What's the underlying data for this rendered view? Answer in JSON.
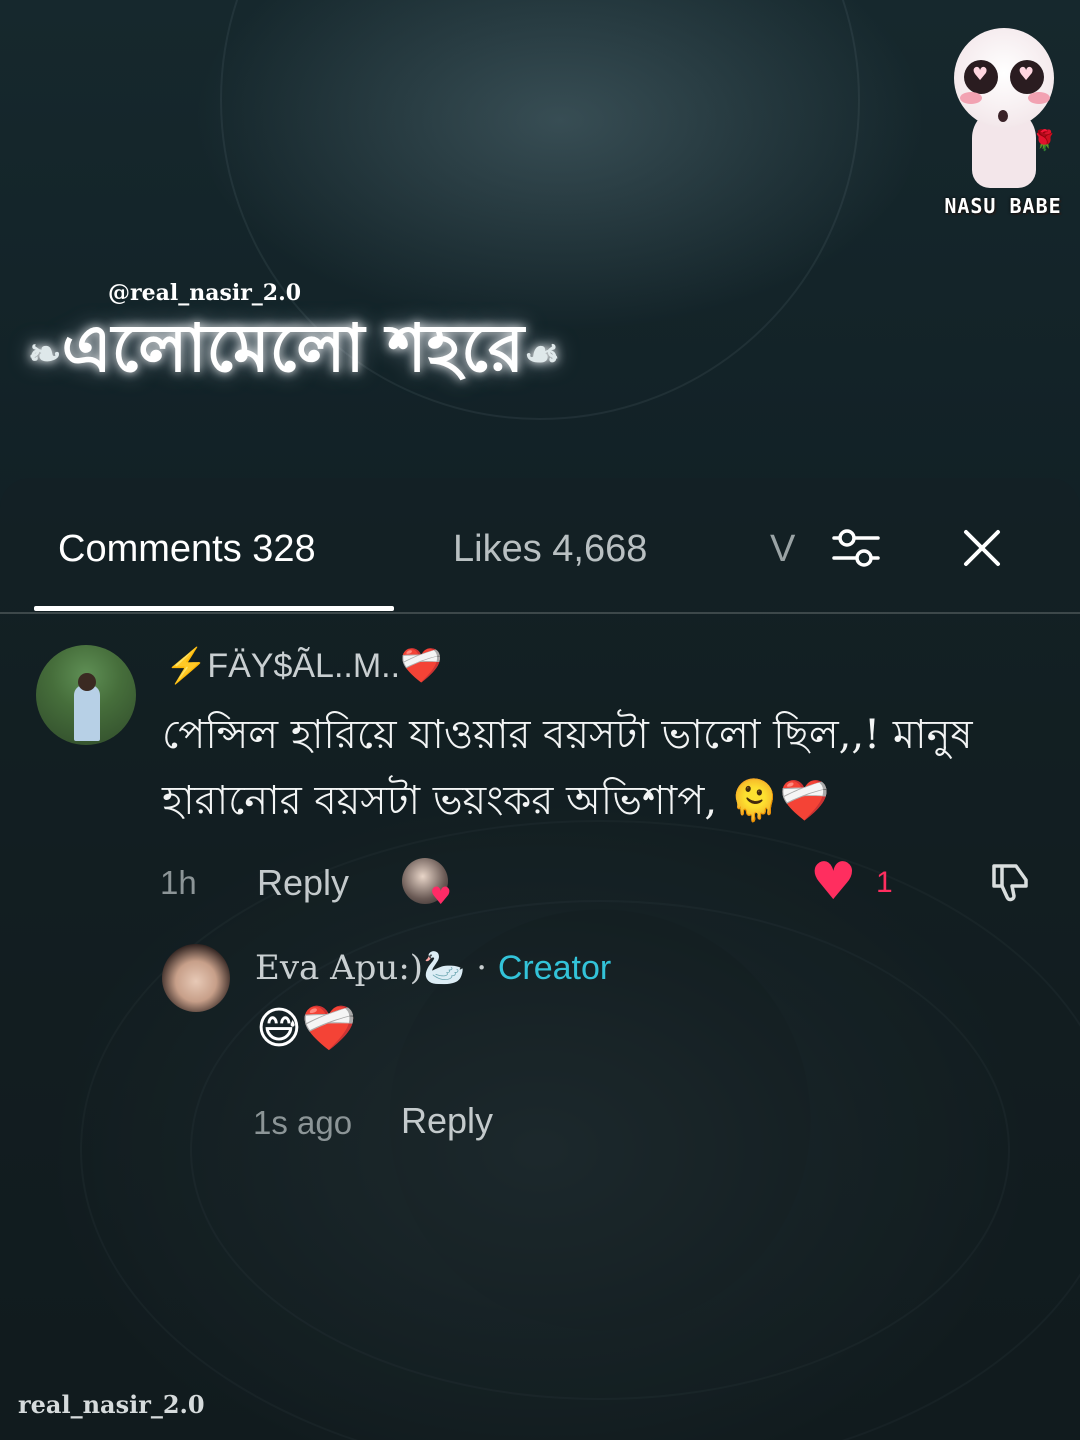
{
  "overlay": {
    "brand_name": "NASU BABE",
    "handle": "@real_nasir_2.0",
    "song_title": "এলোমেলো শহরে",
    "watermark": "real_nasir_2.0"
  },
  "tabs": {
    "comments_label": "Comments 328",
    "likes_label": "Likes 4,668",
    "more_label": "V",
    "filter_icon": "sliders-icon",
    "close_icon": "close-icon"
  },
  "comment": {
    "author": "⚡FÄY$ÃL..M..❤️‍🩹",
    "text": "পেন্সিল হারিয়ে যাওয়ার বয়সটা ভালো ছিল,,! মানুষ হারানোর বয়সটা ভয়ংকর অভিশাপ, 🫠❤️‍🩹",
    "time": "1h",
    "reply_label": "Reply",
    "like_count": "1",
    "liked": true,
    "colors": {
      "like": "#ff2e5f"
    }
  },
  "reply": {
    "author": "Eva Apu:)🦢",
    "separator": "·",
    "badge": "Creator",
    "text": "😅❤️‍🩹",
    "time": "1s ago",
    "reply_label": "Reply",
    "colors": {
      "badge": "#33c3d9"
    }
  }
}
